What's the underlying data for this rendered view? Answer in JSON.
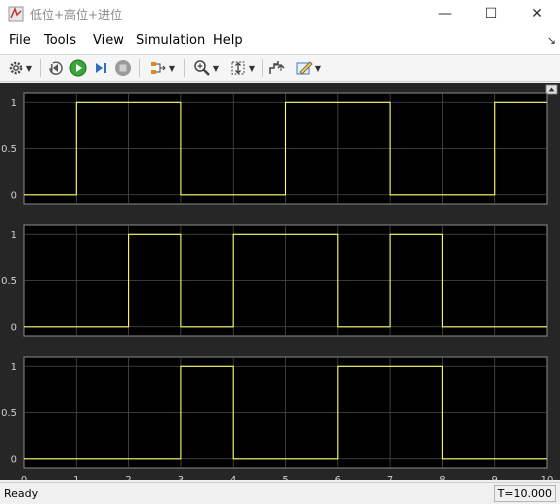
{
  "window": {
    "title": "低位+高位+进位",
    "minimize": "—",
    "maximize": "☐",
    "close": "✕"
  },
  "menu": {
    "items": [
      "File",
      "Tools",
      "View",
      "Simulation",
      "Help"
    ]
  },
  "toolbar": {
    "icons": [
      "settings-gear-icon",
      "step-back-icon",
      "run-icon",
      "step-forward-icon",
      "stop-icon",
      "signal-selector-icon",
      "zoom-icon",
      "autoscale-icon",
      "restore-icon",
      "style-icon"
    ]
  },
  "colors": {
    "plot_bg": "#000000",
    "figure_bg": "#262626",
    "signal": "#ffff66",
    "grid": "#4d4d4d"
  },
  "chart_data": [
    {
      "type": "line",
      "style": "step",
      "x": [
        0,
        1,
        1,
        3,
        3,
        5,
        5,
        7,
        7,
        9,
        9,
        10
      ],
      "y": [
        0,
        0,
        1,
        1,
        0,
        0,
        1,
        1,
        0,
        0,
        1,
        1
      ],
      "xlim": [
        0,
        10
      ],
      "ylim": [
        -0.1,
        1.1
      ],
      "yticks": [
        "0",
        "0.5",
        "1"
      ],
      "grid": true
    },
    {
      "type": "line",
      "style": "step",
      "x": [
        0,
        2,
        2,
        3,
        3,
        4,
        4,
        6,
        6,
        7,
        7,
        8,
        8,
        10
      ],
      "y": [
        0,
        0,
        1,
        1,
        0,
        0,
        1,
        1,
        0,
        0,
        1,
        1,
        0,
        0
      ],
      "xlim": [
        0,
        10
      ],
      "ylim": [
        -0.1,
        1.1
      ],
      "yticks": [
        "0",
        "0.5",
        "1"
      ],
      "grid": true
    },
    {
      "type": "line",
      "style": "step",
      "x": [
        0,
        3,
        3,
        4,
        4,
        6,
        6,
        8,
        8,
        10
      ],
      "y": [
        0,
        0,
        1,
        1,
        0,
        0,
        1,
        1,
        0,
        0
      ],
      "xlim": [
        0,
        10
      ],
      "ylim": [
        -0.1,
        1.1
      ],
      "yticks": [
        "0",
        "0.5",
        "1"
      ],
      "xticks": [
        "0",
        "1",
        "2",
        "3",
        "4",
        "5",
        "6",
        "7",
        "8",
        "9",
        "10"
      ],
      "grid": true
    }
  ],
  "status": {
    "text": "Ready",
    "time": "T=10.000"
  }
}
